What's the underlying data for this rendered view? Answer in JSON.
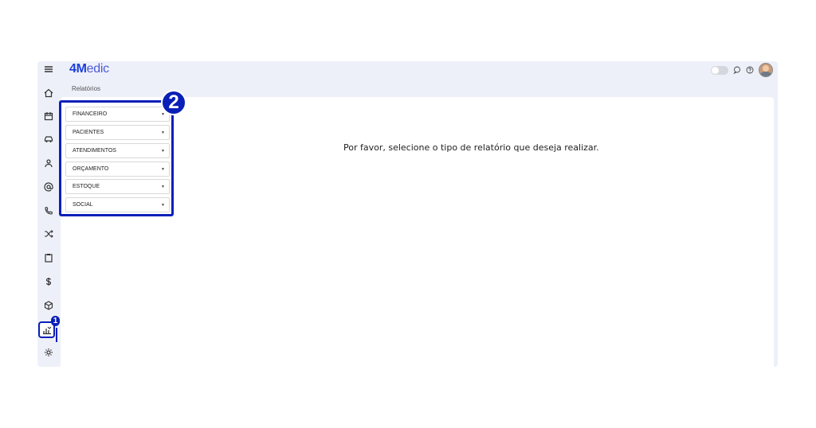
{
  "header": {
    "logo_strong": "4M",
    "logo_light": "edic",
    "breadcrumb": "Relatórios"
  },
  "sidebar": {
    "icons": [
      "menu-icon",
      "home-icon",
      "calendar-icon",
      "car-icon",
      "user-icon",
      "at-icon",
      "phone-icon",
      "shuffle-icon",
      "clipboard-icon",
      "dollar-icon",
      "box-icon",
      "reports-icon",
      "settings-icon"
    ],
    "active_index": 11
  },
  "annotations": {
    "badge1": "1",
    "badge2": "2"
  },
  "reports": {
    "items": [
      {
        "label": "FINANCEIRO"
      },
      {
        "label": "PACIENTES"
      },
      {
        "label": "ATENDIMENTOS"
      },
      {
        "label": "ORÇAMENTO"
      },
      {
        "label": "ESTOQUE"
      },
      {
        "label": "SOCIAL"
      }
    ],
    "caret": "▼"
  },
  "main": {
    "message": "Por favor, selecione o tipo de relatório que deseja realizar."
  },
  "colors": {
    "accent": "#0a1fb8",
    "brand": "#1a3fdd",
    "app_bg": "#eef0f9"
  }
}
